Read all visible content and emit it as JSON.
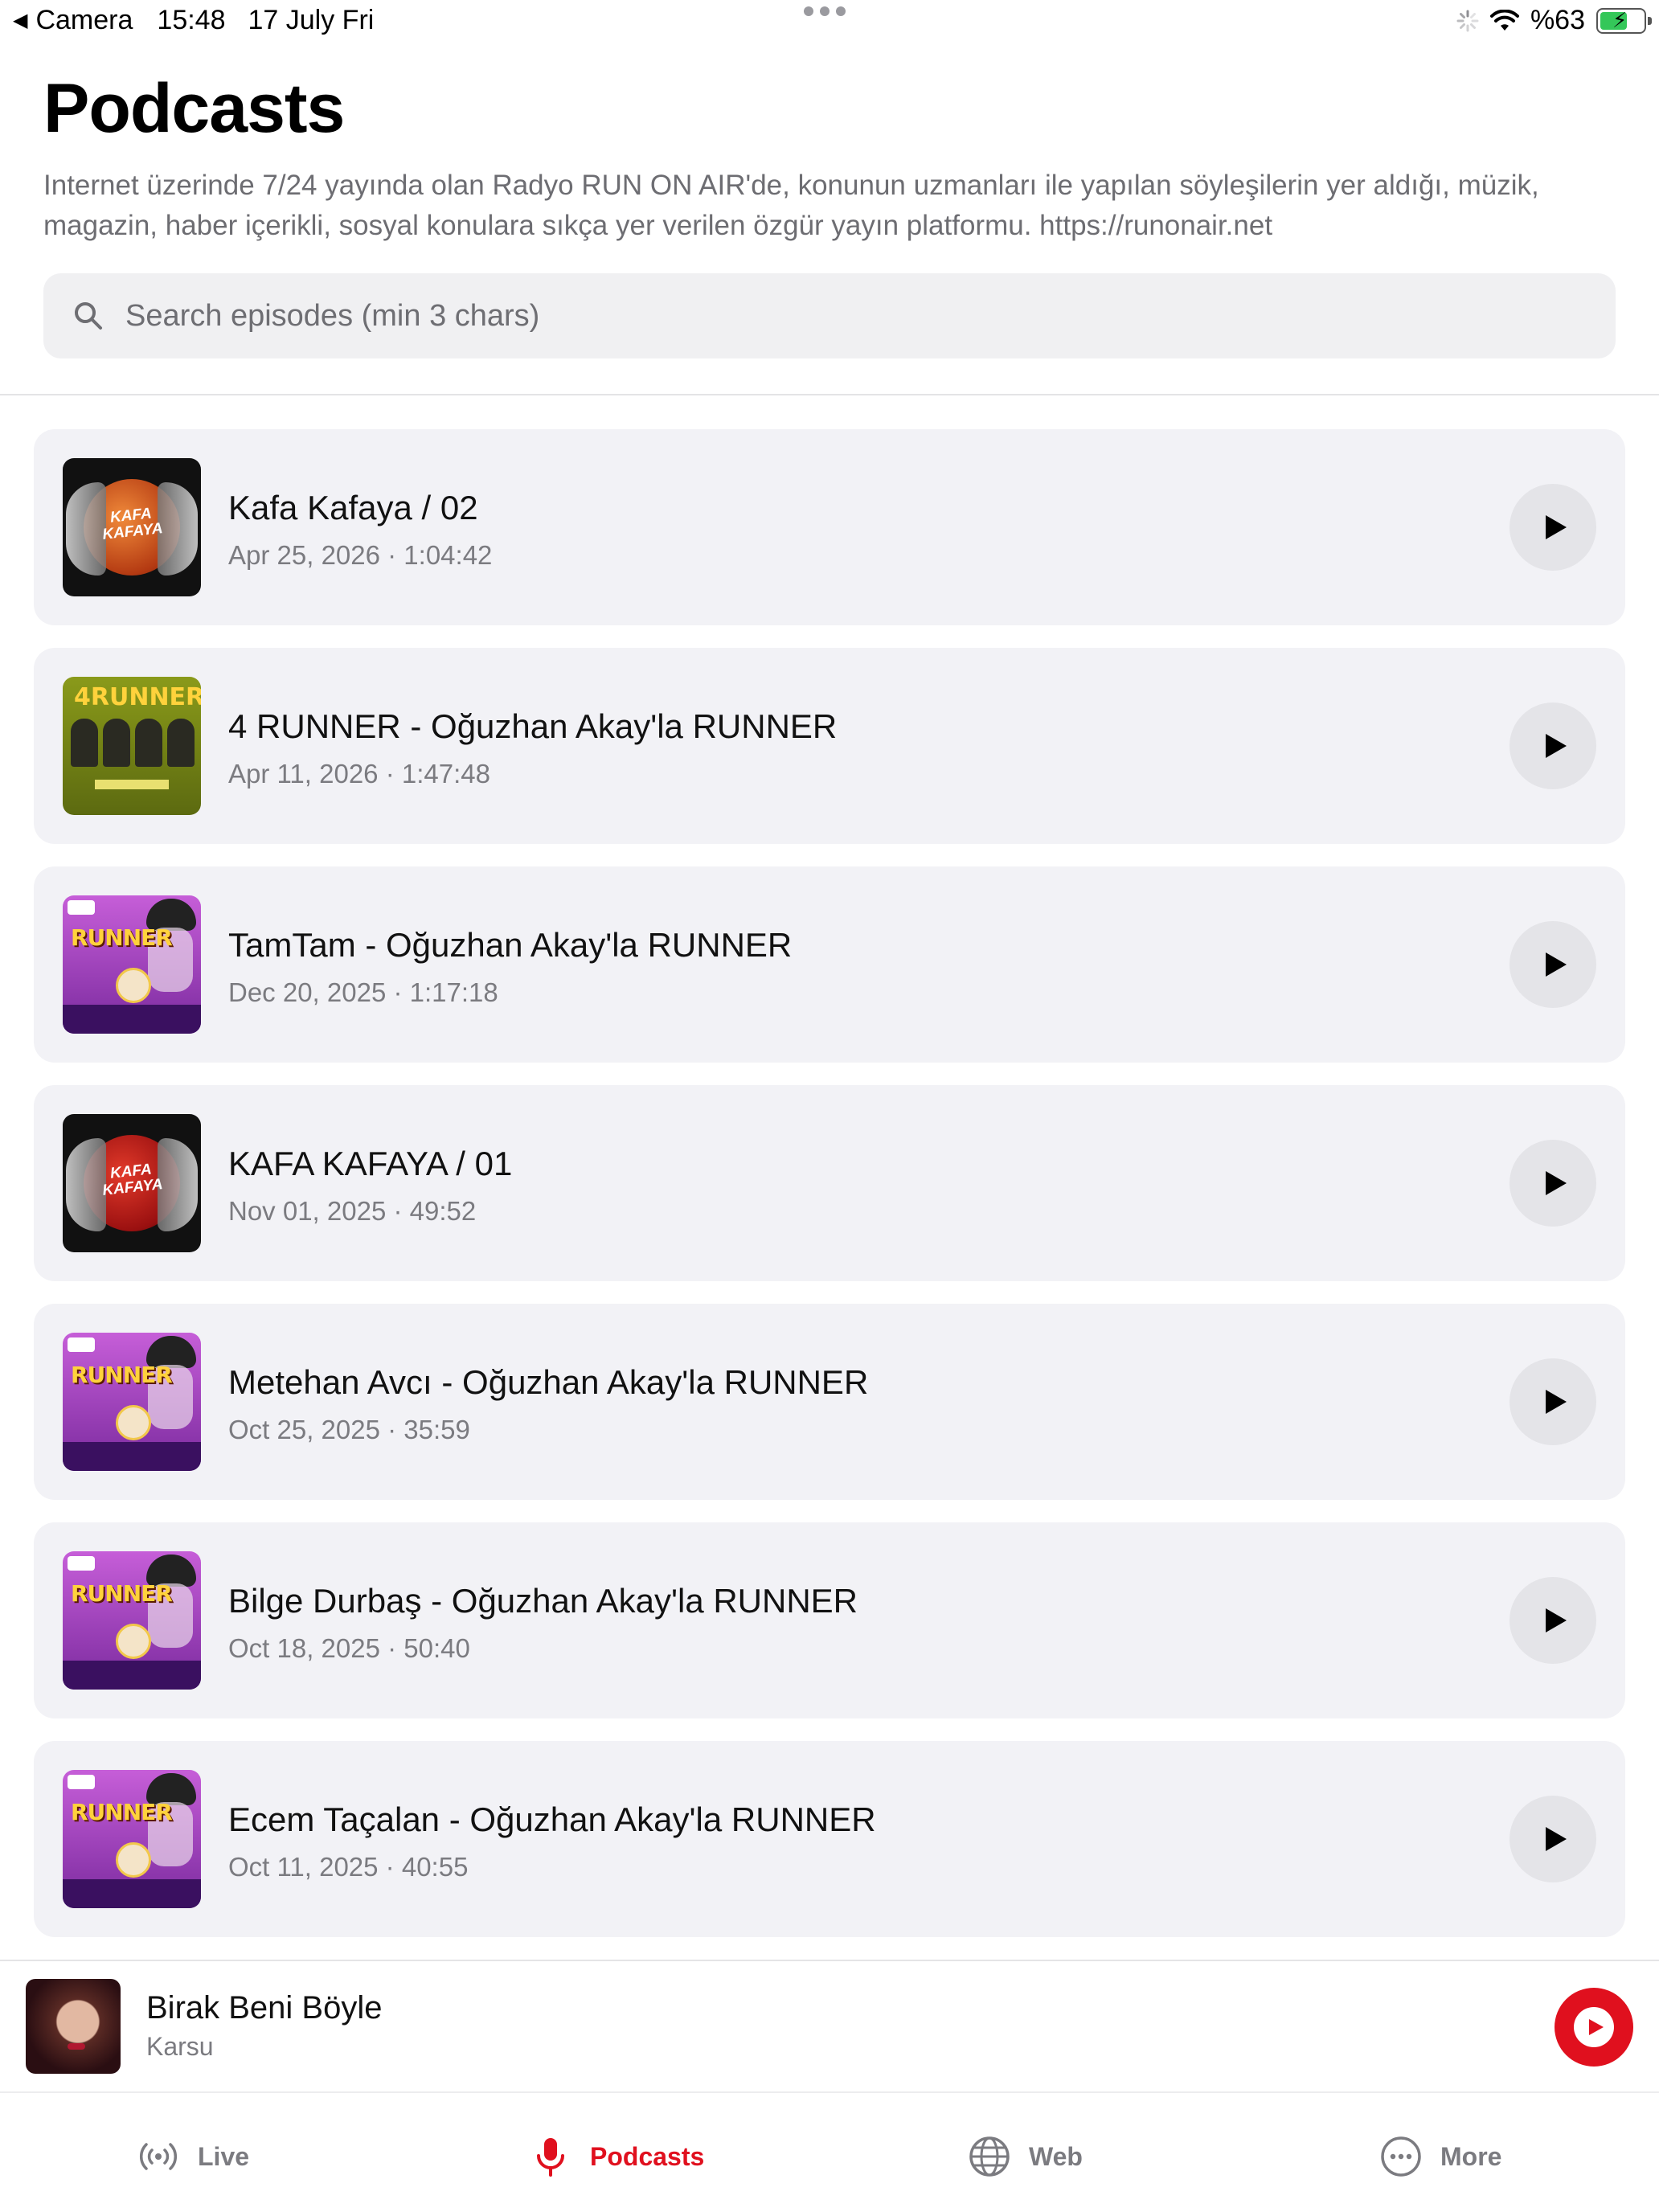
{
  "status_bar": {
    "back_label": "Camera",
    "time": "15:48",
    "date": "17 July Fri",
    "battery": "%63",
    "battery_fraction": 0.63
  },
  "header": {
    "title": "Podcasts",
    "description": "Internet üzerinde 7/24 yayında olan Radyo RUN ON AIR'de, konunun uzmanları ile yapılan söyleşilerin yer aldığı, müzik, magazin, haber içerikli, sosyal konulara sıkça yer verilen özgür yayın platformu. https://runonair.net"
  },
  "search": {
    "placeholder": "Search episodes (min 3 chars)",
    "value": ""
  },
  "episodes": [
    {
      "title": "Kafa Kafaya / 02",
      "meta": "Apr 25, 2026 · 1:04:42",
      "thumb_text": "KAFA KAFAYA"
    },
    {
      "title": "4 RUNNER - Oğuzhan Akay'la RUNNER",
      "meta": "Apr 11, 2026 · 1:47:48",
      "thumb_text": "4RUNNER"
    },
    {
      "title": "TamTam - Oğuzhan Akay'la RUNNER",
      "meta": "Dec 20, 2025 · 1:17:18",
      "thumb_text": "RUNNER"
    },
    {
      "title": "KAFA KAFAYA / 01",
      "meta": "Nov 01, 2025 · 49:52",
      "thumb_text": "KAFA KAFAYA"
    },
    {
      "title": "Metehan Avcı - Oğuzhan Akay'la RUNNER",
      "meta": "Oct 25, 2025 · 35:59",
      "thumb_text": "RUNNER"
    },
    {
      "title": "Bilge Durbaş - Oğuzhan Akay'la RUNNER",
      "meta": "Oct 18, 2025 · 50:40",
      "thumb_text": "RUNNER"
    },
    {
      "title": "Ecem Taçalan - Oğuzhan Akay'la RUNNER",
      "meta": "Oct 11, 2025 · 40:55",
      "thumb_text": "RUNNER"
    }
  ],
  "mini_player": {
    "title": "Birak Beni Böyle",
    "artist": "Karsu"
  },
  "tabbar": {
    "tabs": [
      {
        "label": "Live",
        "icon": "broadcast-icon"
      },
      {
        "label": "Podcasts",
        "icon": "microphone-icon"
      },
      {
        "label": "Web",
        "icon": "globe-icon"
      },
      {
        "label": "More",
        "icon": "ellipsis-circle-icon"
      }
    ],
    "active": "Podcasts"
  },
  "colors": {
    "accent": "#e0101e",
    "card_bg": "#f2f2f6",
    "secondary_text": "#7b7b80"
  }
}
